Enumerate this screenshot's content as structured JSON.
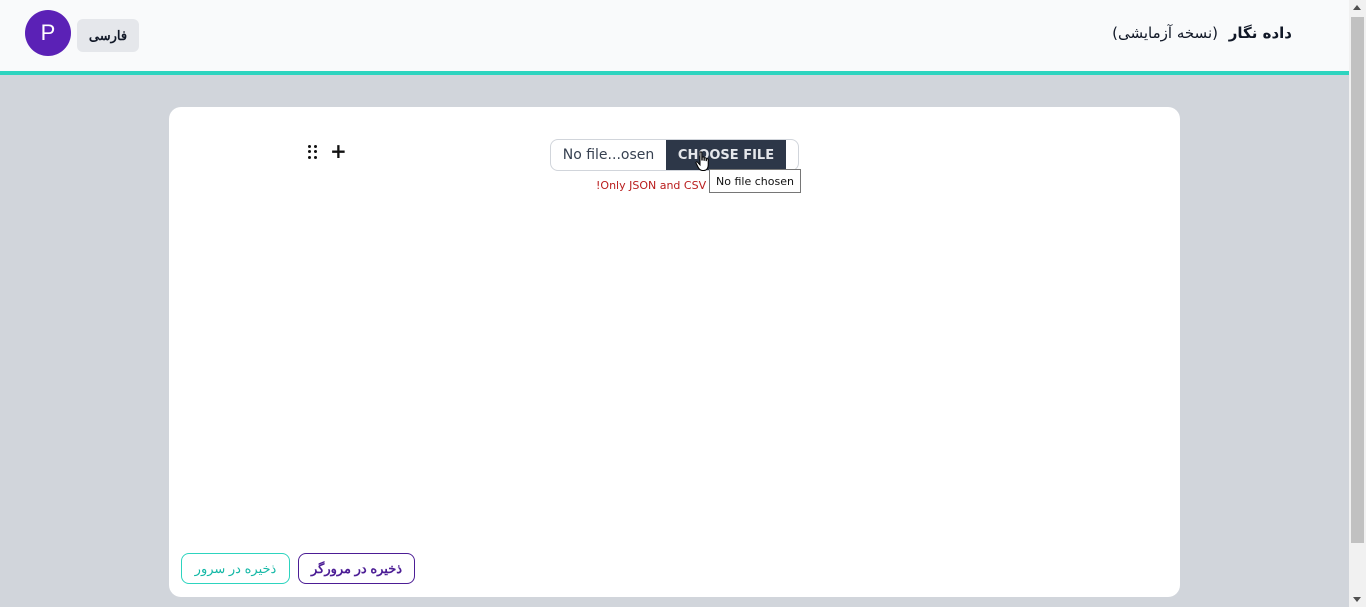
{
  "header": {
    "avatar_letter": "P",
    "language_button": "فارسی",
    "app_name": "داده نگار",
    "app_version": "(نسخه آزمایشی)"
  },
  "editor": {
    "file_input": {
      "file_name": "No file...osen",
      "choose_button": "CHOOSE FILE",
      "hint": "!Only JSON and CSV",
      "tooltip": "No file chosen"
    },
    "icons": {
      "drag": "drag-handle-icon",
      "add": "plus-icon"
    }
  },
  "footer_buttons": {
    "save_browser": "ذخیره در مرورگر",
    "save_server": "ذخیره در سرور"
  },
  "colors": {
    "accent": "#2dd4bf",
    "avatar": "#5b21b6",
    "primary_button": "#4c1d95",
    "error_text": "#b91c1c",
    "page_bg": "#d1d5db"
  }
}
